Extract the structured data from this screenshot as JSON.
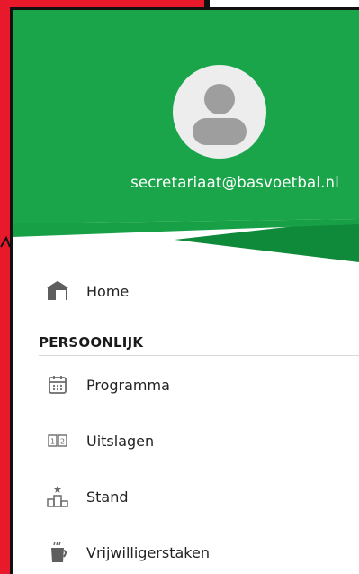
{
  "account": {
    "email": "secretariaat@basvoetbal.nl"
  },
  "menu": {
    "home": {
      "label": "Home",
      "icon": "home-icon"
    },
    "section_title": "PERSOONLIJK",
    "items": [
      {
        "label": "Programma",
        "icon": "calendar-icon"
      },
      {
        "label": "Uitslagen",
        "icon": "scoreboard-icon"
      },
      {
        "label": "Stand",
        "icon": "podium-icon"
      },
      {
        "label": "Vrijwilligerstaken",
        "icon": "coffee-cup-icon"
      }
    ]
  },
  "colors": {
    "header_green": "#1aa54a",
    "header_dark_green": "#0f8a3a",
    "background_red": "#e8192a",
    "icon_grey": "#6b6b6b"
  }
}
